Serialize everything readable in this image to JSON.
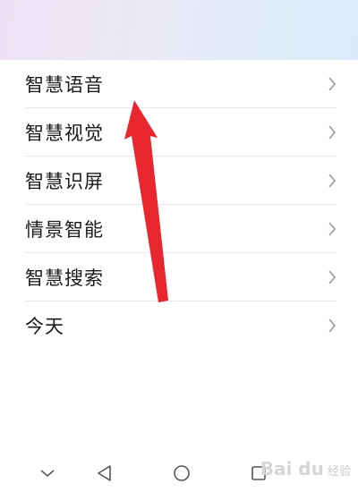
{
  "menu": {
    "items": [
      {
        "label": "智慧语音"
      },
      {
        "label": "智慧视觉"
      },
      {
        "label": "智慧识屏"
      },
      {
        "label": "情景智能"
      },
      {
        "label": "智慧搜索"
      },
      {
        "label": "今天"
      }
    ]
  },
  "annotation": {
    "arrow_color": "#e8262e"
  },
  "watermark": {
    "logo": "Bai du",
    "text": "经验"
  },
  "icons": {
    "chevron": "chevron-right-icon",
    "nav_down": "chevron-down-icon",
    "nav_back": "triangle-back-icon",
    "nav_home": "circle-home-icon",
    "nav_recent": "square-recent-icon"
  }
}
